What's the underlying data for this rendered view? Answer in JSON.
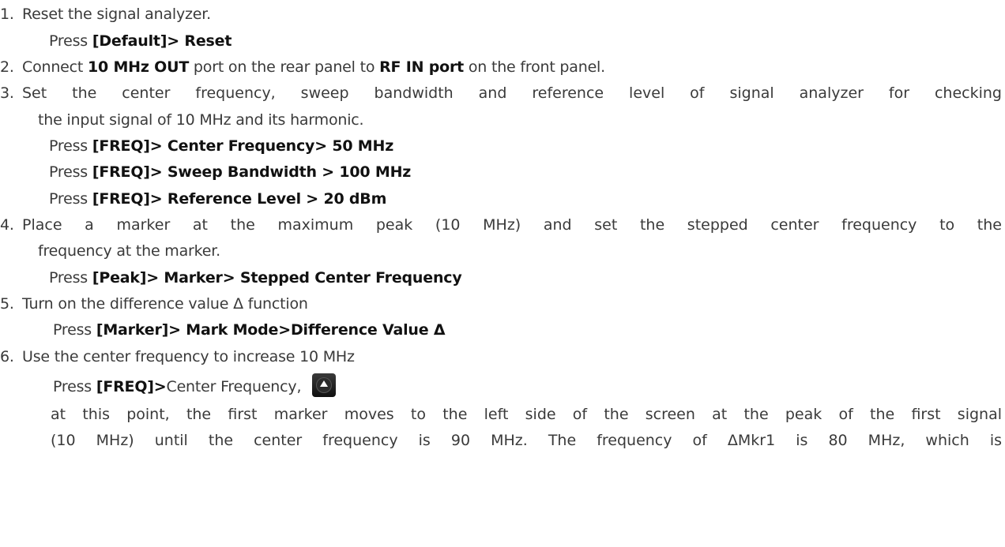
{
  "steps": [
    {
      "num": "1.",
      "text": "Reset the signal analyzer."
    },
    {
      "num": "2.",
      "text_pre": "Connect ",
      "bold1": "10 MHz OUT",
      "text_mid": " port on the rear panel to ",
      "bold2": "RF IN port",
      "text_post": " on the front panel."
    },
    {
      "num": "3.",
      "line1": "Set the center frequency, sweep bandwidth and reference level of signal analyzer for checking",
      "line2": "the input signal of 10 MHz and its harmonic."
    },
    {
      "num": "4.",
      "line1": "Place a marker at the maximum peak (10 MHz) and set the stepped center frequency to the",
      "line2": "frequency at the marker."
    },
    {
      "num": "5.",
      "text": "Turn on the difference value Δ function"
    },
    {
      "num": "6.",
      "text": "Use the center frequency to increase 10 MHz"
    }
  ],
  "press": "Press ",
  "commands": {
    "c1": "[Default]> Reset",
    "c3a": "[FREQ]> Center Frequency> 50 MHz",
    "c3b": "[FREQ]> Sweep Bandwidth > 100 MHz",
    "c3c": "[FREQ]> Reference Level > 20 dBm",
    "c4": "[Peak]> Marker> Stepped Center Frequency",
    "c5": "[Marker]> Mark Mode>Difference Value Δ",
    "c6_bold": "[FREQ]>",
    "c6_rest": "Center Frequency,"
  },
  "paragraph": {
    "line1": "at this point, the first marker moves to the left side of the screen at the peak of the first signal",
    "line2": "(10 MHz) until the center frequency is 90 MHz. The frequency of ΔMkr1 is 80 MHz, which is"
  },
  "icon": "up-arrow-button-icon"
}
